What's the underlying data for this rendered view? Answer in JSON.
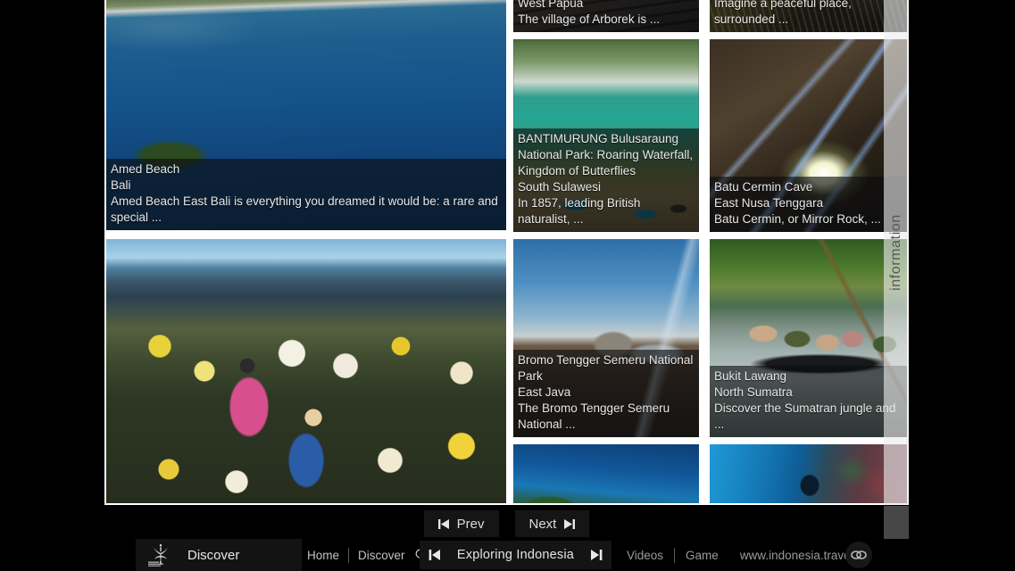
{
  "app": {
    "title": "Exploring Indonesia",
    "brand_label": "Discover",
    "logo_name": "wonderful-indonesia-logo"
  },
  "grid": {
    "info_tab_label": "information",
    "tiles": [
      {
        "id": "amed",
        "title": "Amed Beach",
        "region": "Bali",
        "desc": "Amed Beach East Bali is everything you dreamed it would be: a rare and special ...",
        "caption_position": "bottom"
      },
      {
        "id": "papua",
        "title": "",
        "region": "West Papua",
        "desc": "The village of Arborek is ...",
        "caption_position": "bottom"
      },
      {
        "id": "imagine",
        "title": "",
        "region": "",
        "desc": "Imagine a peaceful place, surrounded ...",
        "caption_position": "bottom"
      },
      {
        "id": "bantimurung",
        "title": "BANTIMURUNG Bulusaraung National Park: Roaring Waterfall, Kingdom of Butterflies",
        "region": "South Sulawesi",
        "desc": "In 1857, leading British naturalist, ...",
        "caption_position": "bottom"
      },
      {
        "id": "batucermin",
        "title": "Batu Cermin Cave",
        "region": "East Nusa Tenggara",
        "desc": "Batu Cermin, or Mirror Rock, ...",
        "caption_position": "bottom"
      },
      {
        "id": "flowers",
        "title": "",
        "region": "",
        "desc": "",
        "caption_position": "none"
      },
      {
        "id": "bromo",
        "title": "Bromo Tengger Semeru National Park",
        "region": "East Java",
        "desc": "The Bromo Tengger Semeru National ...",
        "caption_position": "bottom"
      },
      {
        "id": "bukitlawang",
        "title": "Bukit Lawang",
        "region": "North Sumatra",
        "desc": "Discover the Sumatran jungle and ...",
        "caption_position": "bottom"
      },
      {
        "id": "blue",
        "title": "",
        "region": "",
        "desc": "",
        "caption_position": "none"
      },
      {
        "id": "diving",
        "title": "",
        "region": "",
        "desc": "",
        "caption_position": "none"
      }
    ]
  },
  "pager": {
    "prev_label": "Prev",
    "next_label": "Next",
    "prev_icon": "skip-back-icon",
    "next_icon": "skip-forward-icon"
  },
  "bottom_bar": {
    "nav": {
      "home_label": "Home",
      "discover_label": "Discover",
      "search_icon": "search-icon",
      "prev_icon": "skip-back-icon"
    },
    "slideshow": {
      "title": "Exploring Indonesia",
      "prev_icon": "skip-back-icon",
      "next_icon": "skip-forward-icon"
    },
    "right": {
      "videos_label": "Videos",
      "game_label": "Game",
      "url_label": "www.indonesia.travel",
      "link_icon": "chain-link-icon"
    }
  },
  "colors": {
    "background": "#000000",
    "frame": "#ffffff",
    "caption_overlay": "rgba(10,12,14,0.62)",
    "bar_background": "#000000",
    "button_background": "#151515",
    "text_primary": "#e6e6e6",
    "text_secondary": "#9a9a9a"
  }
}
